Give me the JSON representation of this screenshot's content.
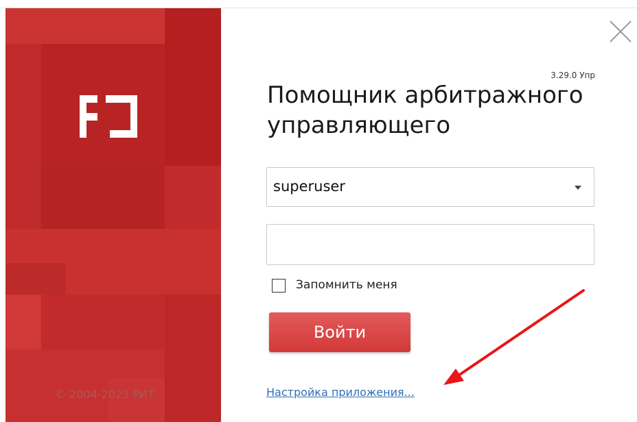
{
  "window": {
    "close_icon": "close-icon"
  },
  "sidebar": {
    "logo_icon": "app-logo-icon",
    "copyright": "© 2004-2023 РИТ"
  },
  "header": {
    "version": "3.29.0 Упр",
    "title": "Помощник арбитражного\nуправляющего"
  },
  "login_form": {
    "username": {
      "value": "superuser",
      "dropdown_icon": "chevron-down-icon"
    },
    "password": {
      "value": ""
    },
    "remember_me": {
      "label": "Запомнить меня",
      "checked": false
    },
    "login_button_label": "Войти",
    "settings_link": "Настройка приложения..."
  },
  "annotation": {
    "arrow_icon": "red-arrow-icon",
    "arrow_color": "#e8161a"
  },
  "colors": {
    "brand_red": "#c42c2c",
    "button_red": "#d94545",
    "link_blue": "#2f6fb4"
  }
}
